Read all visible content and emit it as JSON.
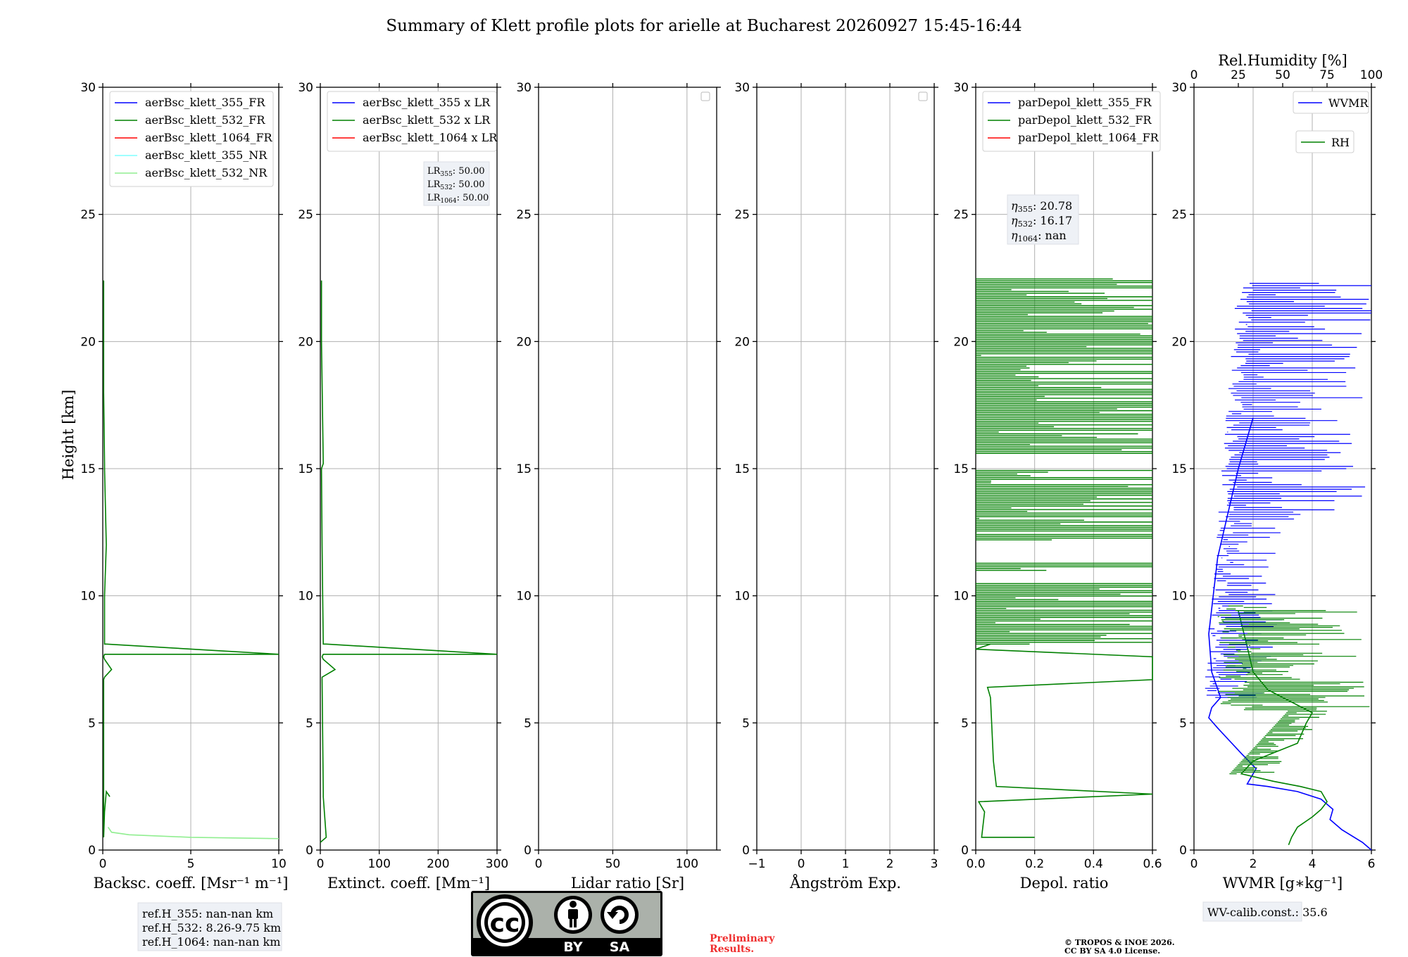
{
  "title": "Summary of Klett profile plots for arielle at Bucharest 20260927 15:45-16:44",
  "ylabel": "Height [km]",
  "colors": {
    "blue": "#0000ff",
    "green": "#008000",
    "red": "#ff0000",
    "cyan": "#7fffff",
    "lightgreen": "#90ee90"
  },
  "panels": [
    {
      "id": "bsc",
      "xlabel": "Backsc. coeff. [Msr$^{-1}$ m$^{-1}$]",
      "xlabel_text": "Backsc. coeff. [Msr⁻¹ m⁻¹]",
      "xlim": [
        0,
        10
      ],
      "xticks": [
        "0",
        "5",
        "10"
      ],
      "legend": [
        {
          "label": "aerBsc_klett_355_FR",
          "color": "#0000ff"
        },
        {
          "label": "aerBsc_klett_532_FR",
          "color": "#008000"
        },
        {
          "label": "aerBsc_klett_1064_FR",
          "color": "#ff0000"
        },
        {
          "label": "aerBsc_klett_355_NR",
          "color": "#7fffff"
        },
        {
          "label": "aerBsc_klett_532_NR",
          "color": "#90ee90"
        }
      ]
    },
    {
      "id": "ext",
      "xlabel_text": "Extinct. coeff. [Mm⁻¹]",
      "xlim": [
        0,
        300
      ],
      "xticks": [
        "0",
        "100",
        "200",
        "300"
      ],
      "legend": [
        {
          "label": "aerBsc_klett_355 x LR",
          "color": "#0000ff"
        },
        {
          "label": "aerBsc_klett_532 x LR",
          "color": "#008000"
        },
        {
          "label": "aerBsc_klett_1064 x LR",
          "color": "#ff0000"
        }
      ],
      "lr_box": [
        {
          "name": "LR",
          "sub": "355",
          "value": ": 50.00"
        },
        {
          "name": "LR",
          "sub": "532",
          "value": ": 50.00"
        },
        {
          "name": "LR",
          "sub": "1064",
          "value": ": 50.00"
        }
      ]
    },
    {
      "id": "lr",
      "xlabel_text": "Lidar ratio [Sr]",
      "xlim": [
        0,
        120
      ],
      "xticks": [
        "0",
        "50",
        "100"
      ],
      "legend": []
    },
    {
      "id": "ang",
      "xlabel_text": "Ångström Exp.",
      "xlim": [
        -1,
        3
      ],
      "xticks": [
        "−1",
        "0",
        "1",
        "2",
        "3"
      ],
      "legend": []
    },
    {
      "id": "dep",
      "xlabel_text": "Depol. ratio",
      "xlim": [
        0,
        0.6
      ],
      "xticks": [
        "0.0",
        "0.2",
        "0.4",
        "0.6"
      ],
      "legend": [
        {
          "label": "parDepol_klett_355_FR",
          "color": "#0000ff"
        },
        {
          "label": "parDepol_klett_532_FR",
          "color": "#008000"
        },
        {
          "label": "parDepol_klett_1064_FR",
          "color": "#ff0000"
        }
      ],
      "eta_box": [
        {
          "name": "η",
          "sub": "355",
          "value": ": 20.78"
        },
        {
          "name": "η",
          "sub": "532",
          "value": ": 16.17"
        },
        {
          "name": "η",
          "sub": "1064",
          "value": ": nan"
        }
      ]
    },
    {
      "id": "wv",
      "xlabel_text": "WVMR [g∗kg⁻¹]",
      "xlim": [
        0,
        6
      ],
      "xticks": [
        "0",
        "2",
        "4",
        "6"
      ],
      "top_label": "Rel.Humidity [%]",
      "top_ticks": [
        "0",
        "25",
        "50",
        "75",
        "100"
      ],
      "legend_wvmr": {
        "label": "WVMR",
        "color": "#0000ff"
      },
      "legend_rh": {
        "label": "RH",
        "color": "#008000"
      }
    }
  ],
  "yticks": [
    "0",
    "5",
    "10",
    "15",
    "20",
    "25",
    "30"
  ],
  "ref_box": [
    "ref.H_355: nan-nan km",
    "ref.H_532: 8.26-9.75 km",
    "ref.H_1064: nan-nan km"
  ],
  "wv_calib": "WV-calib.const.: 35.6",
  "license_badge": {
    "left": "BY",
    "right": "SA"
  },
  "preliminary": [
    "Preliminary",
    "Results."
  ],
  "copyright": [
    "© TROPOS & INOE 2026.",
    "CC BY SA 4.0 License."
  ],
  "chart_data": [
    {
      "type": "line",
      "panel": "bsc",
      "xlabel": "Backsc. coeff. [Msr⁻¹ m⁻¹]",
      "ylabel": "Height [km]",
      "xlim": [
        0,
        10
      ],
      "ylim": [
        0,
        30
      ],
      "series": [
        {
          "name": "aerBsc_klett_532_FR",
          "x": [
            0.4,
            0.2,
            0.1,
            0.05,
            0.05,
            0.1,
            0.5,
            0.1,
            0.05,
            0.1,
            10,
            0.2,
            0.1,
            0.1,
            0.2,
            0.1,
            0.1,
            0.05,
            0.05,
            0.05,
            0.05
          ],
          "y": [
            2.1,
            2.3,
            1.5,
            0.5,
            6.7,
            6.8,
            7.1,
            7.5,
            7.6,
            7.7,
            7.7,
            8.1,
            8.1,
            10,
            12,
            15,
            15.2,
            18,
            20,
            21.5,
            22.4
          ]
        },
        {
          "name": "aerBsc_klett_532_NR",
          "x": [
            0.3,
            0.5,
            1.5,
            5,
            10
          ],
          "y": [
            0.9,
            0.7,
            0.6,
            0.5,
            0.45
          ]
        }
      ]
    },
    {
      "type": "line",
      "panel": "ext",
      "xlabel": "Extinct. coeff. [Mm⁻¹]",
      "ylabel": "Height [km]",
      "xlim": [
        0,
        300
      ],
      "ylim": [
        0,
        30
      ],
      "series": [
        {
          "name": "aerBsc_klett_532 x LR",
          "x": [
            0,
            10,
            5,
            5,
            3,
            3,
            25,
            5,
            3,
            5,
            300,
            10,
            5,
            4,
            3,
            2,
            5,
            2,
            2
          ],
          "y": [
            0.3,
            0.5,
            2.1,
            2.3,
            6.7,
            6.8,
            7.1,
            7.5,
            7.6,
            7.7,
            7.7,
            8.1,
            8.1,
            10,
            12,
            15,
            15.2,
            20,
            22.4
          ]
        }
      ]
    },
    {
      "type": "line",
      "panel": "dep",
      "xlabel": "Depol. ratio",
      "ylabel": "Height [km]",
      "xlim": [
        0,
        0.6
      ],
      "ylim": [
        0,
        30
      ],
      "series": [
        {
          "name": "parDepol_klett_532_FR",
          "x": [
            0.2,
            0.02,
            0.03,
            0.01,
            0.6,
            0.07,
            0.06,
            0.05,
            0.04,
            0.6,
            0.6,
            0.0,
            0.05
          ],
          "y": [
            0.5,
            0.5,
            1.5,
            1.9,
            2.2,
            2.5,
            3.5,
            6.0,
            6.4,
            6.7,
            7.6,
            7.9,
            8.1
          ]
        }
      ]
    },
    {
      "type": "line",
      "panel": "wv",
      "xlabel": "WVMR [g∗kg⁻¹]",
      "ylabel": "Height [km]",
      "xlim": [
        0,
        6
      ],
      "ylim": [
        0,
        30
      ],
      "series": [
        {
          "name": "WVMR",
          "x": [
            6,
            5.7,
            5.0,
            4.6,
            4.7,
            4.3,
            3.5,
            2.5,
            1.8,
            1.9,
            2.1,
            1.6,
            1.2,
            0.8,
            0.5,
            0.6,
            0.9,
            0.6,
            0.5,
            0.6,
            0.7,
            0.8,
            1.0,
            1.2,
            1.5,
            2.0
          ],
          "y": [
            0,
            0.3,
            0.8,
            1.2,
            1.6,
            2.0,
            2.3,
            2.5,
            2.6,
            2.8,
            3.2,
            3.8,
            4.3,
            4.8,
            5.2,
            5.6,
            6.0,
            7.0,
            8.5,
            9.5,
            10.5,
            11.5,
            12.5,
            13.5,
            15.0,
            17.0
          ]
        },
        {
          "name": "RH",
          "x": [
            3.2,
            3.3,
            3.5,
            4.0,
            4.3,
            4.5,
            4.3,
            3.6,
            2.7,
            1.6,
            2.0,
            3.5,
            3.8,
            4.0,
            3.0,
            2.5,
            2.0,
            1.8,
            1.5
          ],
          "y": [
            0.2,
            0.5,
            0.9,
            1.3,
            1.6,
            1.9,
            2.3,
            2.5,
            2.7,
            3.0,
            3.5,
            4.2,
            5.0,
            5.4,
            6.0,
            6.3,
            7.0,
            8.0,
            9.4
          ]
        }
      ]
    }
  ]
}
